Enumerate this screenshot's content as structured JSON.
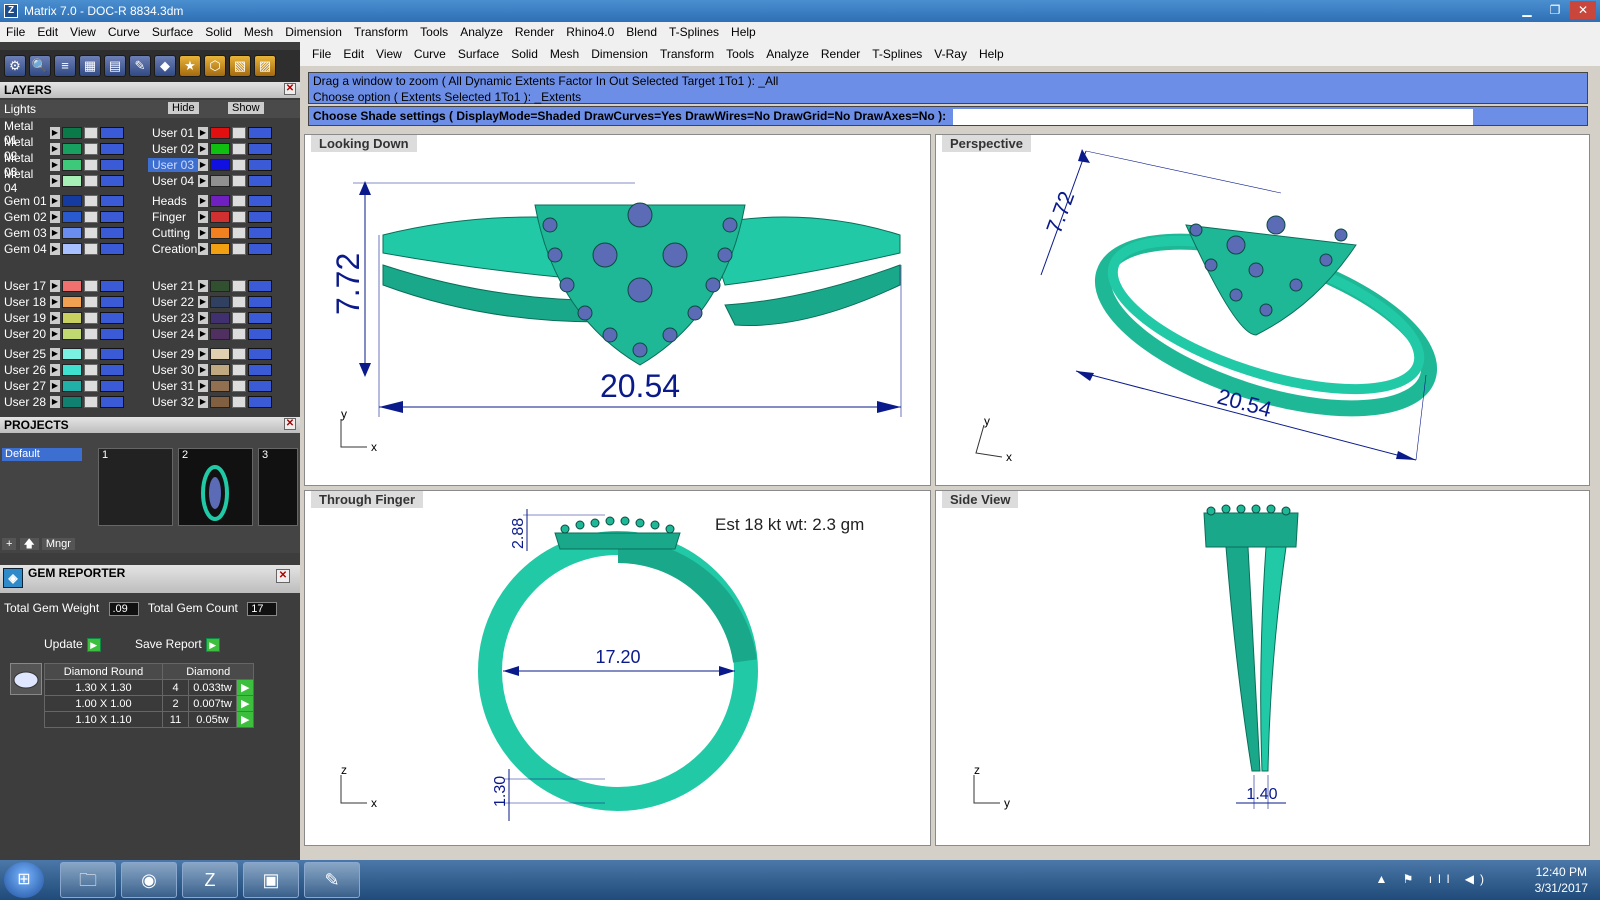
{
  "window": {
    "title": "Matrix 7.0 - DOC-R 8834.3dm",
    "app_icon": "Z",
    "btn_min": "▁",
    "btn_max": "❐",
    "btn_close": "✕"
  },
  "main_menu": [
    "File",
    "Edit",
    "View",
    "Curve",
    "Surface",
    "Solid",
    "Mesh",
    "Dimension",
    "Transform",
    "Tools",
    "Analyze",
    "Render",
    "Rhino4.0",
    "Blend",
    "T-Splines",
    "Help"
  ],
  "left": {
    "toolbar_icons": [
      "gear-icon",
      "zoom-icon",
      "layers-icon",
      "box-icon",
      "page-icon",
      "edit-icon",
      "cube-icon",
      "star-icon",
      "snap-icon",
      "grid-icon",
      "render-icon"
    ],
    "layers_title": "LAYERS",
    "lights_label": "Lights",
    "hide_label": "Hide",
    "show_label": "Show",
    "layers_left": [
      {
        "name": "Metal 01",
        "color": "#0a7a48"
      },
      {
        "name": "Metal 02",
        "color": "#18a060"
      },
      {
        "name": "Metal 03",
        "color": "#3ec87a"
      },
      {
        "name": "Metal 04",
        "color": "#a6f0b8"
      },
      {
        "name": "Gem 01",
        "color": "#153aa0"
      },
      {
        "name": "Gem 02",
        "color": "#2a5ad0"
      },
      {
        "name": "Gem 03",
        "color": "#6a8ef0"
      },
      {
        "name": "Gem 04",
        "color": "#a8c0ff"
      },
      {
        "name": "User 17",
        "color": "#f07070"
      },
      {
        "name": "User 18",
        "color": "#f0a050"
      },
      {
        "name": "User 19",
        "color": "#c8d060"
      },
      {
        "name": "User 20",
        "color": "#c0d870"
      },
      {
        "name": "User 25",
        "color": "#7af0e0"
      },
      {
        "name": "User 26",
        "color": "#40e0d0"
      },
      {
        "name": "User 27",
        "color": "#20b0a8"
      },
      {
        "name": "User 28",
        "color": "#108070"
      }
    ],
    "layers_right": [
      {
        "name": "User 01",
        "color": "#e01010"
      },
      {
        "name": "User 02",
        "color": "#10c010"
      },
      {
        "name": "User 03",
        "color": "#1010e0"
      },
      {
        "name": "User 04",
        "color": "#909090"
      },
      {
        "name": "Heads",
        "color": "#7020c0"
      },
      {
        "name": "Finger",
        "color": "#d03030"
      },
      {
        "name": "Cutting",
        "color": "#f08020"
      },
      {
        "name": "Creation",
        "color": "#f0a010"
      },
      {
        "name": "User 21",
        "color": "#305030"
      },
      {
        "name": "User 22",
        "color": "#304060"
      },
      {
        "name": "User 23",
        "color": "#403070"
      },
      {
        "name": "User 24",
        "color": "#503060"
      },
      {
        "name": "User 29",
        "color": "#e0d0b0"
      },
      {
        "name": "User 30",
        "color": "#c0a880"
      },
      {
        "name": "User 31",
        "color": "#907050"
      },
      {
        "name": "User 32",
        "color": "#806040"
      }
    ],
    "projects_title": "PROJECTS",
    "project_default": "Default",
    "thumbs": [
      "1",
      "2",
      "3"
    ],
    "proj_btns": {
      "add": "+",
      "up": "🡅",
      "mngr": "Mngr",
      "plus": "+"
    },
    "gem": {
      "title": "GEM REPORTER",
      "total_weight_label": "Total Gem Weight",
      "total_weight": ".09",
      "total_count_label": "Total Gem Count",
      "total_count": "17",
      "update": "Update",
      "save_report": "Save Report",
      "header": [
        "Diamond Round",
        "Diamond"
      ],
      "rows": [
        {
          "size": "1.30 X 1.30",
          "count": "4",
          "weight": "0.033tw"
        },
        {
          "size": "1.00 X 1.00",
          "count": "2",
          "weight": "0.007tw"
        },
        {
          "size": "1.10 X 1.10",
          "count": "11",
          "weight": "0.05tw"
        }
      ]
    }
  },
  "rhino_menu": [
    "File",
    "Edit",
    "View",
    "Curve",
    "Surface",
    "Solid",
    "Mesh",
    "Dimension",
    "Transform",
    "Tools",
    "Analyze",
    "Render",
    "T-Splines",
    "V-Ray",
    "Help"
  ],
  "command": {
    "line1": "Drag a window to zoom ( All  Dynamic  Extents  Factor  In  Out  Selected  Target  1To1 ): _All",
    "line2": "Choose option ( Extents  Selected  1To1 ): _Extents",
    "prompt": "Choose Shade settings ( DisplayMode=Shaded  DrawCurves=Yes  DrawWires=No  DrawGrid=No  DrawAxes=No ):"
  },
  "viewports": {
    "top_left": {
      "label": "Looking Down",
      "dim_h": "20.54",
      "dim_v": "7.72",
      "ax1": "y",
      "ax2": "x"
    },
    "top_right": {
      "label": "Perspective",
      "dim_h": "20.54",
      "dim_v": "7.72",
      "ax1": "y",
      "ax2": "x"
    },
    "bottom_left": {
      "label": "Through Finger",
      "dim_inner": "17.20",
      "dim_top": "2.88",
      "dim_bottom": "1.30",
      "note": "Est 18 kt wt: 2.3 gm",
      "ax1": "z",
      "ax2": "x"
    },
    "bottom_right": {
      "label": "Side View",
      "dim_bottom": "1.40",
      "ax1": "z",
      "ax2": "y"
    }
  },
  "colors": {
    "metal": "#21c9a6",
    "metal_dark": "#0a6e5a",
    "gem": "#5b6bb5",
    "dim": "#0a1a8a",
    "cmd_bg": "#6c8ee6"
  },
  "taskbar": {
    "time": "12:40 PM",
    "date": "3/31/2017",
    "apps": [
      "folder-icon",
      "chrome-icon",
      "matrix-icon",
      "explorer-icon",
      "paint-icon"
    ],
    "tray": "▲ ⚑ ıll ◀)"
  }
}
